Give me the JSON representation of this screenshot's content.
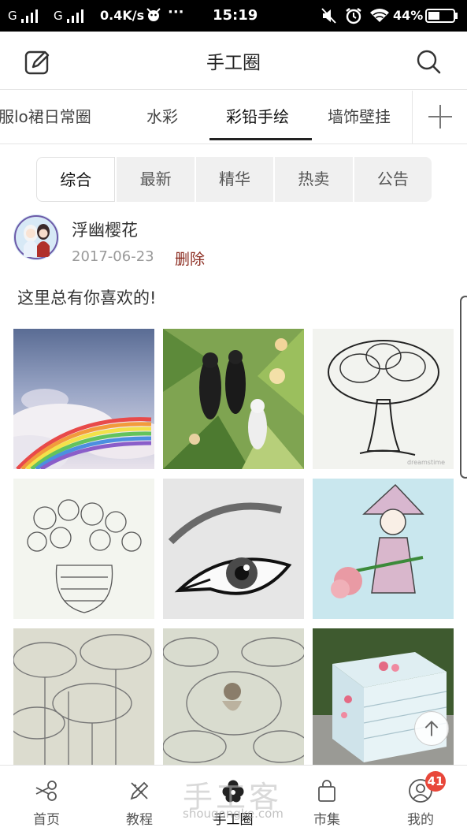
{
  "status_bar": {
    "sim1": "G",
    "sim2": "G",
    "speed": "0.4K/s",
    "dots": "···",
    "time": "15:19",
    "battery": "44%"
  },
  "header": {
    "title": "手工圈",
    "left_icon": "edit-icon",
    "right_icon": "search-icon"
  },
  "tabs": {
    "items": [
      "服lo裙日常圈",
      "水彩",
      "彩铅手绘",
      "墙饰壁挂"
    ],
    "active_index": 2,
    "add_icon": "plus-icon"
  },
  "segments": {
    "items": [
      "综合",
      "最新",
      "精华",
      "热卖",
      "公告"
    ],
    "active_index": 0
  },
  "post": {
    "username": "浮幽樱花",
    "date": "2017-06-23",
    "delete_label": "删除",
    "content": "这里总有你喜欢的!"
  },
  "photos": [
    "clouds-rainbow-photo",
    "parrots-jungle-photo",
    "tree-drawing-photo",
    "flower-vase-drawing-photo",
    "eye-drawing-photo",
    "girl-flower-drawing-photo",
    "lotus-drawing-photo",
    "lotus-girl-drawing-photo",
    "painted-box-photo"
  ],
  "bottom_nav": {
    "items": [
      {
        "label": "首页",
        "icon": "scissors-icon"
      },
      {
        "label": "教程",
        "icon": "pencil-ruler-icon"
      },
      {
        "label": "手工圈",
        "icon": "flower-icon"
      },
      {
        "label": "市集",
        "icon": "shopping-bag-icon"
      },
      {
        "label": "我的",
        "icon": "user-icon"
      }
    ],
    "active_index": 2,
    "badge": "41"
  },
  "watermark": {
    "text": "手工客",
    "url": "shougongke.com"
  },
  "colors": {
    "delete": "#8b2b1f",
    "badge": "#e8473a"
  }
}
